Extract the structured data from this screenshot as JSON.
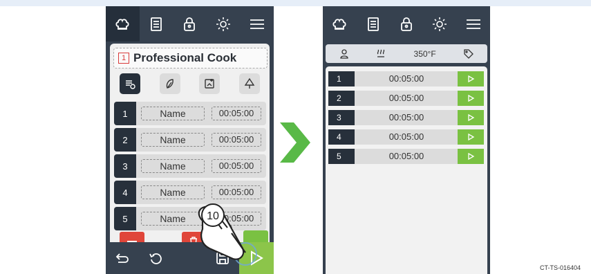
{
  "left_screen": {
    "topbar_icons": [
      "chef-hat-icon",
      "notes-icon",
      "lock-icon",
      "brightness-icon",
      "menu-icon"
    ],
    "program_number": "1",
    "program_title": "Professional Cook",
    "tool_icons": [
      "recipe-icon",
      "leaf-icon",
      "image-icon",
      "tree-icon"
    ],
    "steps": [
      {
        "num": "1",
        "name": "Name",
        "time": "00:05:00"
      },
      {
        "num": "2",
        "name": "Name",
        "time": "00:05:00"
      },
      {
        "num": "3",
        "name": "Name",
        "time": "00:05:00"
      },
      {
        "num": "4",
        "name": "Name",
        "time": "00:05:00"
      },
      {
        "num": "5",
        "name": "Name",
        "time": "00:05:00"
      }
    ],
    "callout_number": "10"
  },
  "right_screen": {
    "topbar_icons": [
      "chef-hat-icon",
      "notes-icon",
      "lock-icon",
      "brightness-icon",
      "menu-icon"
    ],
    "temperature": "350°F",
    "steps": [
      {
        "num": "1",
        "time": "00:05:00"
      },
      {
        "num": "2",
        "time": "00:05:00"
      },
      {
        "num": "3",
        "time": "00:05:00"
      },
      {
        "num": "4",
        "time": "00:05:00"
      },
      {
        "num": "5",
        "time": "00:05:00"
      }
    ]
  },
  "figure_code": "CT-TS-016404",
  "colors": {
    "dark": "#36414f",
    "green": "#7ac142",
    "red": "#e0463a",
    "arrow": "#59b947"
  }
}
